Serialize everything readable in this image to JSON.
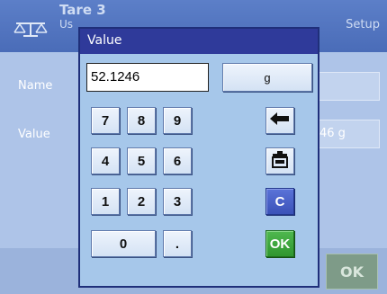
{
  "background": {
    "title": "Tare 3",
    "subtitle": "Us",
    "setup_label": "Setup",
    "name_label": "Name",
    "value_label": "Value",
    "value_field_text": "46 g",
    "ok_label": "OK"
  },
  "dialog": {
    "title": "Value",
    "input_value": "52.1246",
    "unit_button": "g",
    "keys": {
      "k7": "7",
      "k8": "8",
      "k9": "9",
      "k4": "4",
      "k5": "5",
      "k6": "6",
      "k1": "1",
      "k2": "2",
      "k3": "3",
      "k0": "0",
      "dot": "."
    },
    "backspace_icon": "left-arrow-icon",
    "tare_icon": "scale-tare-icon",
    "clear_label": "C",
    "ok_label": "OK"
  },
  "colors": {
    "dialog_title_bar": "#2f3a9a",
    "clear_button": "#3b52b8",
    "ok_button": "#2f962f"
  }
}
